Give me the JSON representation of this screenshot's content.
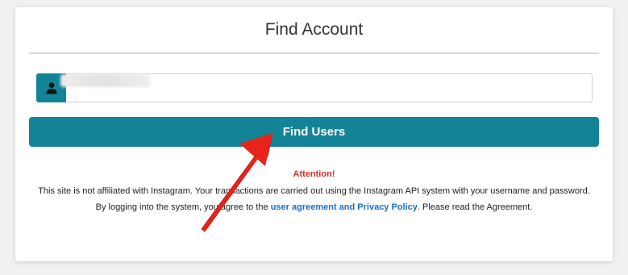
{
  "form": {
    "title": "Find Account",
    "username_value": "",
    "user_icon": "user-icon",
    "submit_label": "Find Users"
  },
  "notice": {
    "heading": "Attention!",
    "line1": "This site is not affiliated with Instagram. Your transactions are carried out using the Instagram API system with your username and password.",
    "line2_before": "By logging into the system, you agree to the ",
    "line2_link": "user agreement and Privacy Policy",
    "line2_after": ". Please read the Agreement."
  },
  "colors": {
    "accent": "#138497",
    "warning": "#c9302c",
    "link": "#1a6fc4",
    "annotation_arrow": "#e8231b"
  }
}
